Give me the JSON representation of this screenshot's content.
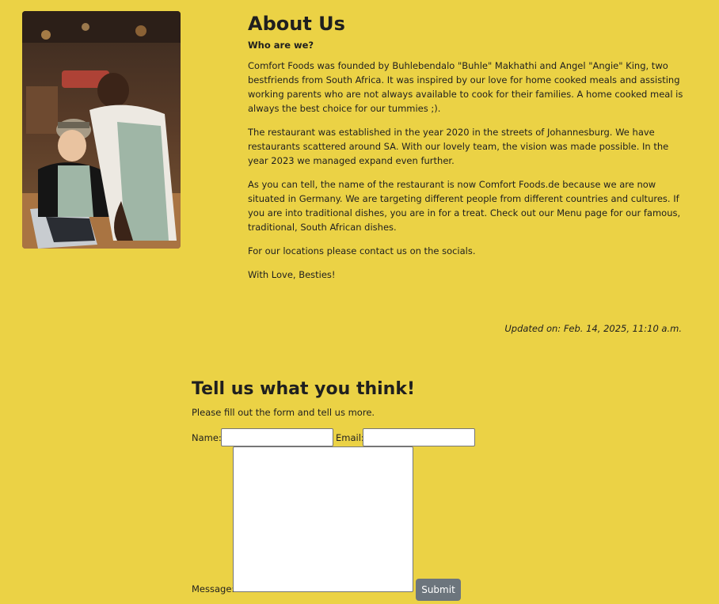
{
  "about": {
    "title": "About Us",
    "subtitle": "Who are we?",
    "paragraphs": [
      "Comfort Foods was founded by Buhlebendalo \"Buhle\" Makhathi and Angel \"Angie\" King, two bestfriends from South Africa. It was inspired by our love for home cooked meals and assisting working parents who are not always available to cook for their families. A home cooked meal is always the best choice for our tummies ;).",
      "The restaurant was established in the year 2020 in the streets of Johannesburg. We have restaurants scattered around SA. With our lovely team, the vision was made possible. In the year 2023 we managed expand even further.",
      "As you can tell, the name of the restaurant is now Comfort Foods.de because we are now situated in Germany. We are targeting different people from different countries and cultures. If you are into traditional dishes, you are in for a treat. Check out our Menu page for our famous, traditional, South African dishes.",
      "For our locations please contact us on the socials.",
      "With Love, Besties!"
    ],
    "updated": "Updated on: Feb. 14, 2025, 11:10 a.m."
  },
  "feedback": {
    "title": "Tell us what you think!",
    "intro": "Please fill out the form and tell us more.",
    "name_label": "Name:",
    "email_label": "Email:",
    "message_label": "Message:",
    "name_value": "",
    "email_value": "",
    "message_value": "",
    "submit_label": "Submit"
  },
  "colors": {
    "background": "#ebd245",
    "submit": "#6c757d"
  }
}
